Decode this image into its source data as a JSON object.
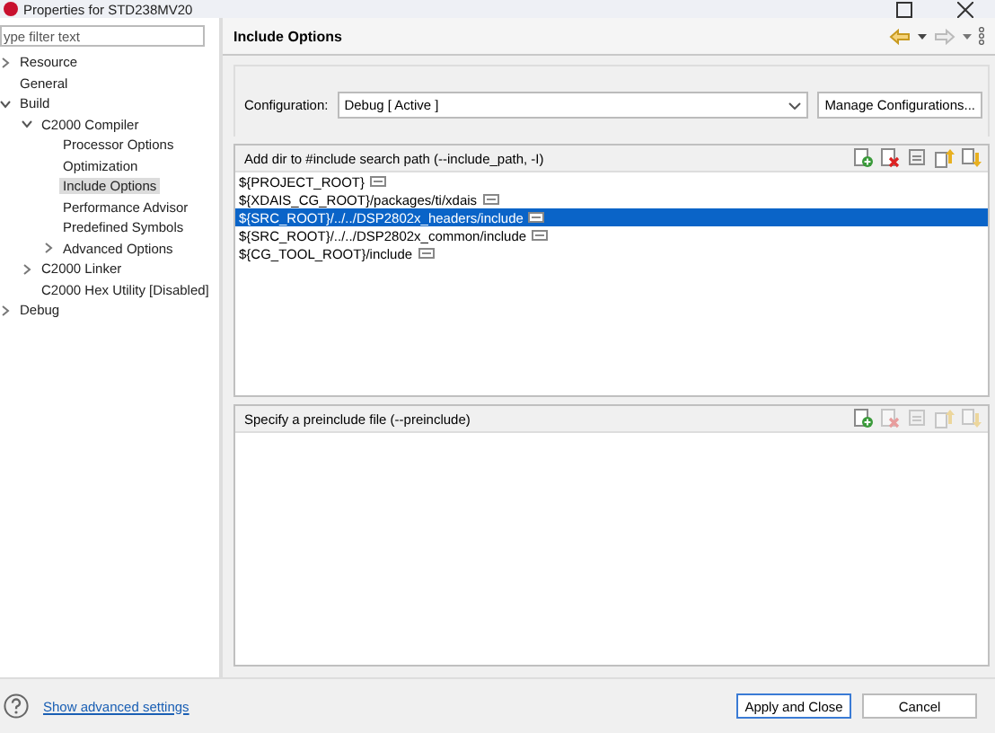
{
  "window": {
    "title": "Properties for STD238MV20"
  },
  "filter": {
    "placeholder": "ype filter text"
  },
  "tree": [
    {
      "label": "Resource",
      "expanded": false,
      "selected": false
    },
    {
      "label": "General",
      "selected": false
    },
    {
      "label": "Build",
      "expanded": true,
      "selected": false,
      "children": [
        {
          "label": "C2000 Compiler",
          "expanded": true,
          "selected": false,
          "children": [
            {
              "label": "Processor Options",
              "selected": false
            },
            {
              "label": "Optimization",
              "selected": false
            },
            {
              "label": "Include Options",
              "selected": true
            },
            {
              "label": "Performance Advisor",
              "selected": false
            },
            {
              "label": "Predefined Symbols",
              "selected": false
            },
            {
              "label": "Advanced Options",
              "expanded": false,
              "selected": false
            }
          ]
        },
        {
          "label": "C2000 Linker",
          "expanded": false,
          "selected": false
        },
        {
          "label": "C2000 Hex Utility  [Disabled]",
          "selected": false
        }
      ]
    },
    {
      "label": "Debug",
      "expanded": false,
      "selected": false
    }
  ],
  "page": {
    "title": "Include Options"
  },
  "configuration": {
    "label": "Configuration:",
    "value": "Debug  [ Active ]",
    "button": "Manage Configurations..."
  },
  "include_paths": {
    "title": "Add dir to #include search path (--include_path, -I)",
    "tools": [
      {
        "kind": "add",
        "disabled": false
      },
      {
        "kind": "delete",
        "disabled": false
      },
      {
        "kind": "edit",
        "disabled": false
      },
      {
        "kind": "up",
        "disabled": false
      },
      {
        "kind": "down",
        "disabled": false
      }
    ],
    "rows": [
      {
        "text": "${PROJECT_ROOT}",
        "selected": false
      },
      {
        "text": "${XDAIS_CG_ROOT}/packages/ti/xdais",
        "selected": false
      },
      {
        "text": "${SRC_ROOT}/../../DSP2802x_headers/include",
        "selected": true
      },
      {
        "text": "${SRC_ROOT}/../../DSP2802x_common/include",
        "selected": false
      },
      {
        "text": "${CG_TOOL_ROOT}/include",
        "selected": false
      }
    ]
  },
  "preinclude": {
    "title": "Specify a preinclude file (--preinclude)",
    "tools": [
      {
        "kind": "add",
        "disabled": false
      },
      {
        "kind": "delete",
        "disabled": true
      },
      {
        "kind": "edit",
        "disabled": true
      },
      {
        "kind": "up",
        "disabled": true
      },
      {
        "kind": "down",
        "disabled": true
      }
    ]
  },
  "footer": {
    "link": "Show advanced settings",
    "buttons": [
      "Apply and Close",
      "Cancel"
    ]
  }
}
